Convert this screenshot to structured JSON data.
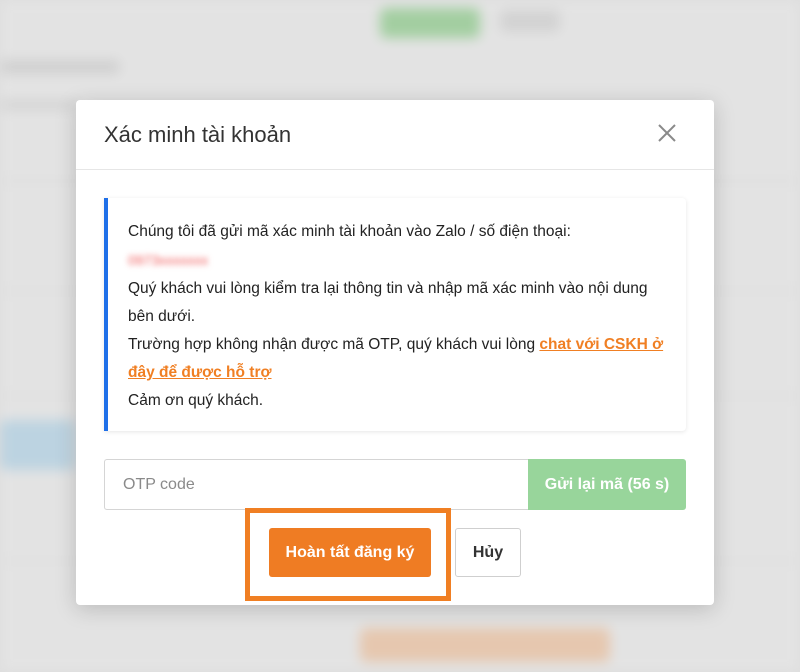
{
  "modal": {
    "title": "Xác minh tài khoản",
    "close_icon": "close-icon"
  },
  "info": {
    "line1": "Chúng tôi đã gửi mã xác minh tài khoản vào Zalo / số điện thoại:",
    "phone_redacted": "0973xxxxxxx",
    "line2": "Quý khách vui lòng kiểm tra lại thông tin và nhập mã xác minh vào nội dung bên dưới.",
    "line3_prefix": "Trường hợp không nhận được mã OTP, quý khách vui lòng ",
    "line3_link": "chat với CSKH ở đây để được hỗ trợ",
    "line4": "Cảm ơn quý khách."
  },
  "otp": {
    "placeholder": "OTP code",
    "value": "",
    "resend_label": "Gửi lại mã (56 s)"
  },
  "actions": {
    "complete_label": "Hoàn tất đăng ký",
    "cancel_label": "Hủy"
  },
  "colors": {
    "accent_orange": "#ef7c23",
    "info_border_blue": "#1e6fe8",
    "resend_green": "#98d59b"
  }
}
